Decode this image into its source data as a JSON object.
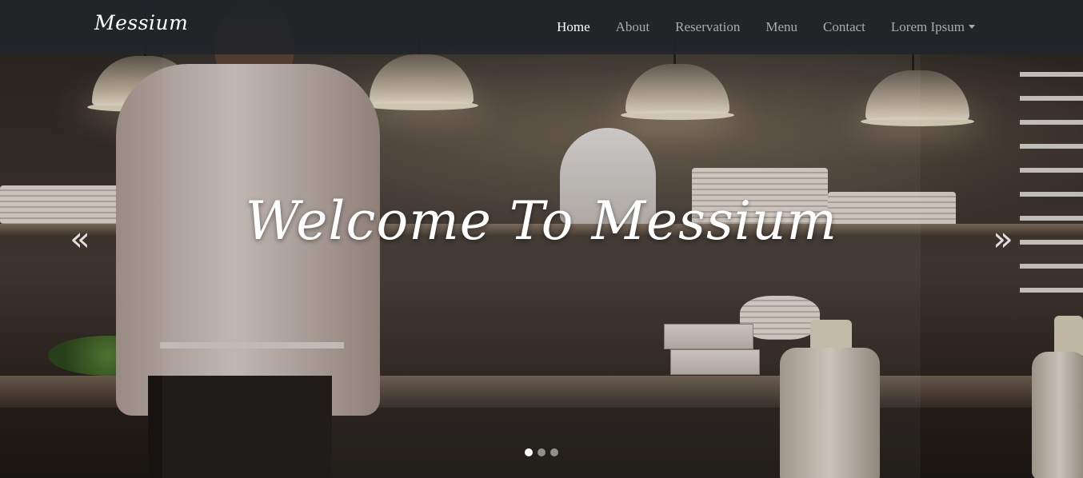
{
  "brand": "Messium",
  "nav": {
    "items": [
      {
        "label": "Home",
        "active": true
      },
      {
        "label": "About",
        "active": false
      },
      {
        "label": "Reservation",
        "active": false
      },
      {
        "label": "Menu",
        "active": false
      },
      {
        "label": "Contact",
        "active": false
      },
      {
        "label": "Lorem Ipsum",
        "active": false,
        "dropdown": true
      }
    ]
  },
  "carousel": {
    "caption": "Welcome To Messium",
    "prev_icon": "double-chevron-left-icon",
    "next_icon": "double-chevron-right-icon",
    "prev_glyph": "«",
    "next_glyph": "»",
    "slide_count": 3,
    "active_index": 0
  },
  "colors": {
    "navbar_bg": "#22262a",
    "nav_link": "#a9acaf",
    "nav_active": "#ffffff",
    "caption": "#ffffff"
  }
}
